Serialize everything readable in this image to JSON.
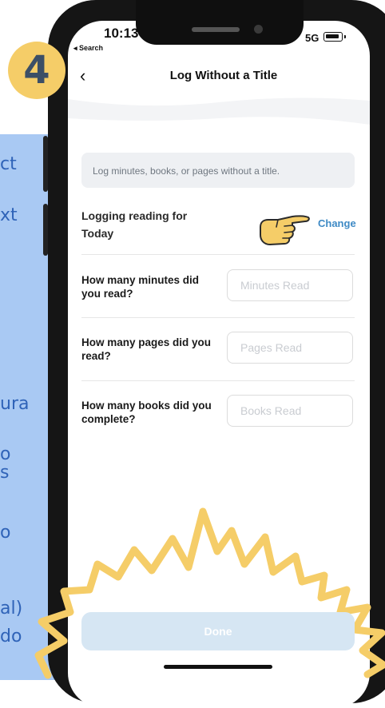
{
  "background_text": {
    "lines": [
      "ct",
      "xt",
      "ura",
      "o",
      "s",
      "o",
      "al)",
      "do"
    ]
  },
  "step_badge": "4",
  "status_bar": {
    "time": "10:13",
    "back_app": "◂ Search",
    "network": "5G"
  },
  "nav": {
    "back_glyph": "‹",
    "title": "Log Without a Title"
  },
  "info": {
    "text": "Log minutes, books, or pages without a title."
  },
  "logging": {
    "label": "Logging reading for",
    "value": "Today",
    "change_label": "Change"
  },
  "questions": [
    {
      "label": "How many minutes did you read?",
      "placeholder": "Minutes Read"
    },
    {
      "label": "How many pages did you read?",
      "placeholder": "Pages Read"
    },
    {
      "label": "How many books did you complete?",
      "placeholder": "Books Read"
    }
  ],
  "done_label": "Done",
  "colors": {
    "accent": "#3e8ac5",
    "done_bg": "#d6e6f3",
    "badge": "#f5cd68",
    "side_panel": "#a9c9f3",
    "side_text": "#2f63b8"
  }
}
